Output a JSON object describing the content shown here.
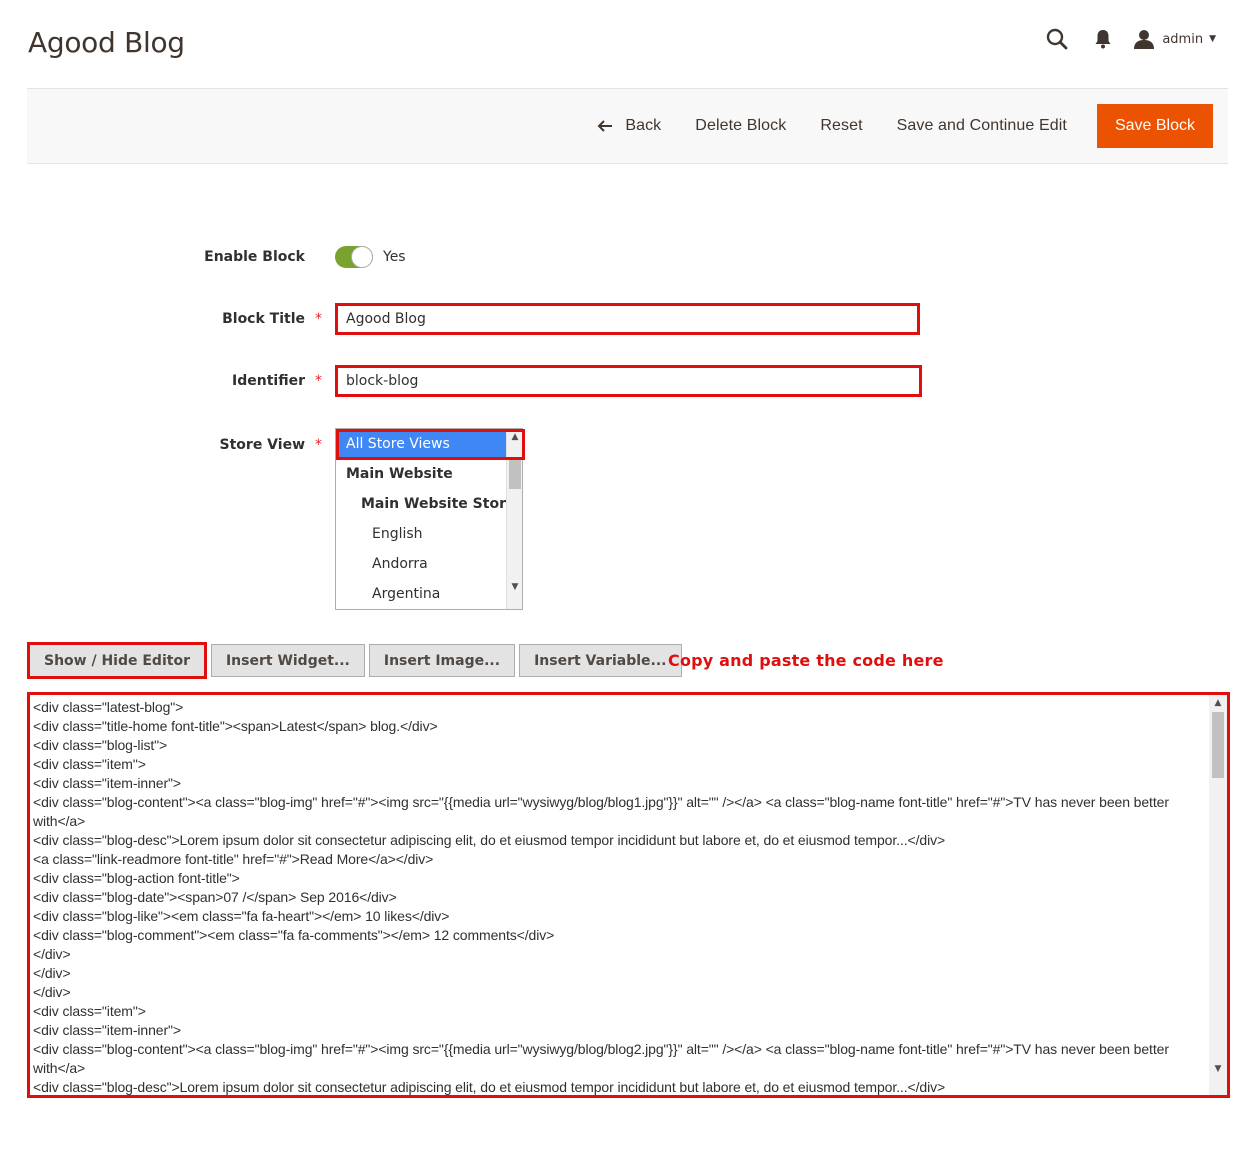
{
  "page": {
    "title": "Agood Blog"
  },
  "header": {
    "user_name": "admin"
  },
  "toolbar": {
    "back_label": "Back",
    "delete_label": "Delete Block",
    "reset_label": "Reset",
    "save_continue_label": "Save and Continue Edit",
    "save_label": "Save Block"
  },
  "form": {
    "enable": {
      "label": "Enable Block",
      "value_label": "Yes",
      "enabled": true
    },
    "title": {
      "label": "Block Title",
      "value": "Agood Blog"
    },
    "identifier": {
      "label": "Identifier",
      "value": "block-blog"
    },
    "store_view": {
      "label": "Store View",
      "options": [
        "All Store Views",
        "Main Website",
        "Main Website Store",
        "English",
        "Andorra",
        "Argentina"
      ],
      "selected": "All Store Views"
    }
  },
  "editor": {
    "show_hide_label": "Show / Hide Editor",
    "insert_widget_label": "Insert Widget...",
    "insert_image_label": "Insert Image...",
    "insert_variable_label": "Insert Variable...",
    "hint": "Copy and paste the code here",
    "lines": [
      "<div class=\"latest-blog\">",
      "<div class=\"title-home font-title\"><span>Latest</span> blog.</div>",
      "<div class=\"blog-list\">",
      "<div class=\"item\">",
      "<div class=\"item-inner\">",
      "<div class=\"blog-content\"><a class=\"blog-img\" href=\"#\"><img src=\"{{media url=\"wysiwyg/blog/blog1.jpg\"}}\" alt=\"\" /></a> <a class=\"blog-name font-title\" href=\"#\">TV has never been better with</a>",
      "<div class=\"blog-desc\">Lorem ipsum dolor sit consectetur adipiscing elit, do et eiusmod tempor incididunt but labore et, do et eiusmod tempor...</div>",
      "<a class=\"link-readmore font-title\" href=\"#\">Read More</a></div>",
      "<div class=\"blog-action font-title\">",
      "<div class=\"blog-date\"><span>07 /</span> Sep 2016</div>",
      "<div class=\"blog-like\"><em class=\"fa fa-heart\"></em> 10 likes</div>",
      "<div class=\"blog-comment\"><em class=\"fa fa-comments\"></em> 12 comments</div>",
      "</div>",
      "</div>",
      "</div>",
      "<div class=\"item\">",
      "<div class=\"item-inner\">",
      "<div class=\"blog-content\"><a class=\"blog-img\" href=\"#\"><img src=\"{{media url=\"wysiwyg/blog/blog2.jpg\"}}\" alt=\"\" /></a> <a class=\"blog-name font-title\" href=\"#\">TV has never been better with</a>",
      "<div class=\"blog-desc\">Lorem ipsum dolor sit consectetur adipiscing elit, do et eiusmod tempor incididunt but labore et, do et eiusmod tempor...</div>"
    ]
  },
  "colors": {
    "accent": "#eb5202",
    "highlight": "#e10e0e",
    "toggle_on": "#79a22e",
    "selected_option": "#3f87f5"
  }
}
